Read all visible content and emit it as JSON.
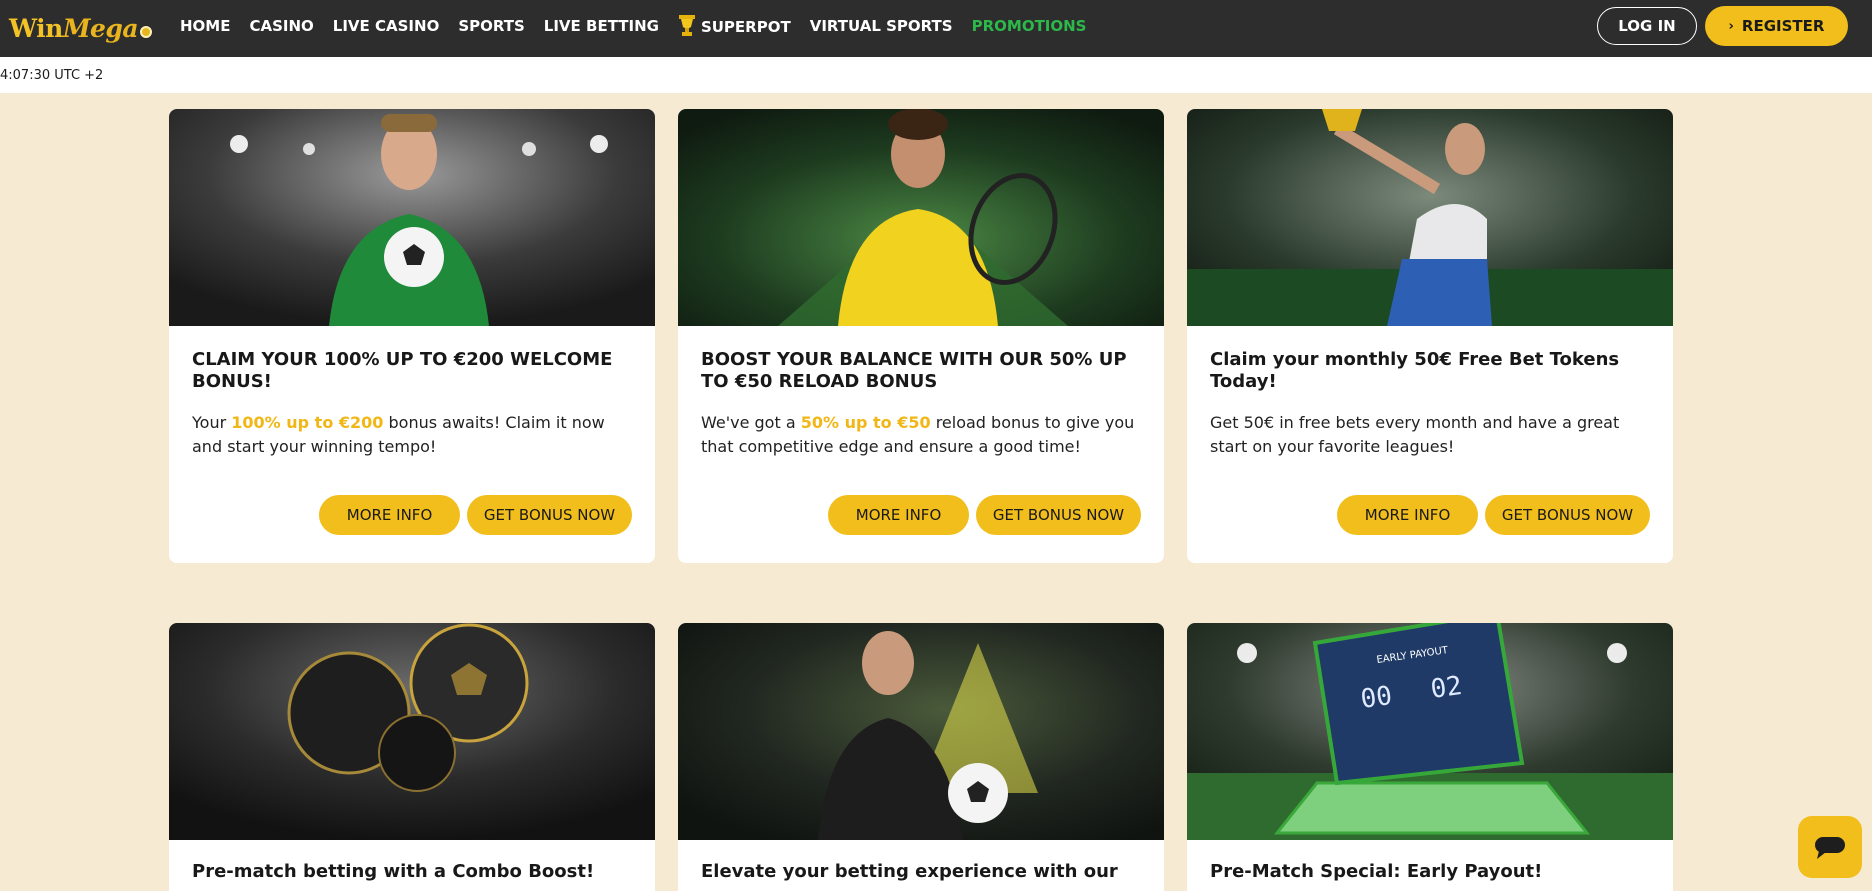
{
  "brand": {
    "logo_win": "Win",
    "logo_mega": "Mega"
  },
  "nav": {
    "items": [
      {
        "label": "HOME"
      },
      {
        "label": "CASINO"
      },
      {
        "label": "LIVE CASINO"
      },
      {
        "label": "SPORTS"
      },
      {
        "label": "LIVE BETTING"
      },
      {
        "label": "SUPERPOT"
      },
      {
        "label": "VIRTUAL SPORTS"
      },
      {
        "label": "PROMOTIONS"
      }
    ],
    "login_label": "LOG IN",
    "register_label": "REGISTER"
  },
  "clock": "4:07:30 UTC +2",
  "cards": [
    {
      "title": "CLAIM YOUR 100% UP TO €200 WELCOME BONUS!",
      "desc_before": "Your ",
      "desc_highlight": "100% up to €200",
      "desc_after": " bonus awaits! Claim it now and start your winning tempo!",
      "more_label": "MORE INFO",
      "get_label": "GET BONUS NOW"
    },
    {
      "title": "BOOST YOUR BALANCE WITH OUR 50% UP TO €50 RELOAD BONUS",
      "desc_before": "We've got a ",
      "desc_highlight": "50% up to €50",
      "desc_after": " reload bonus to give you that competitive edge and ensure a good time!",
      "more_label": "MORE INFO",
      "get_label": "GET BONUS NOW"
    },
    {
      "title": "Claim your monthly 50€ Free Bet Tokens Today!",
      "desc_before": "Get 50€ in free bets every month and have a great start on your favorite leagues!",
      "desc_highlight": "",
      "desc_after": "",
      "more_label": "MORE INFO",
      "get_label": "GET BONUS NOW"
    },
    {
      "title": "Pre-match betting with a Combo Boost!"
    },
    {
      "title": "Elevate your betting experience with our"
    },
    {
      "title": "Pre-Match Special: Early Payout!"
    }
  ],
  "scoreboard": {
    "label": "EARLY PAYOUT",
    "score_left": "00",
    "score_right": "02"
  },
  "colors": {
    "accent": "#f1be1b",
    "header": "#2d2d2d",
    "page_bg": "#f6ead2",
    "promo_green": "#2cb84a"
  },
  "icons": {
    "superpot": "trophy-icon",
    "register": "chevron-right-icon",
    "chat": "chat-icon"
  }
}
